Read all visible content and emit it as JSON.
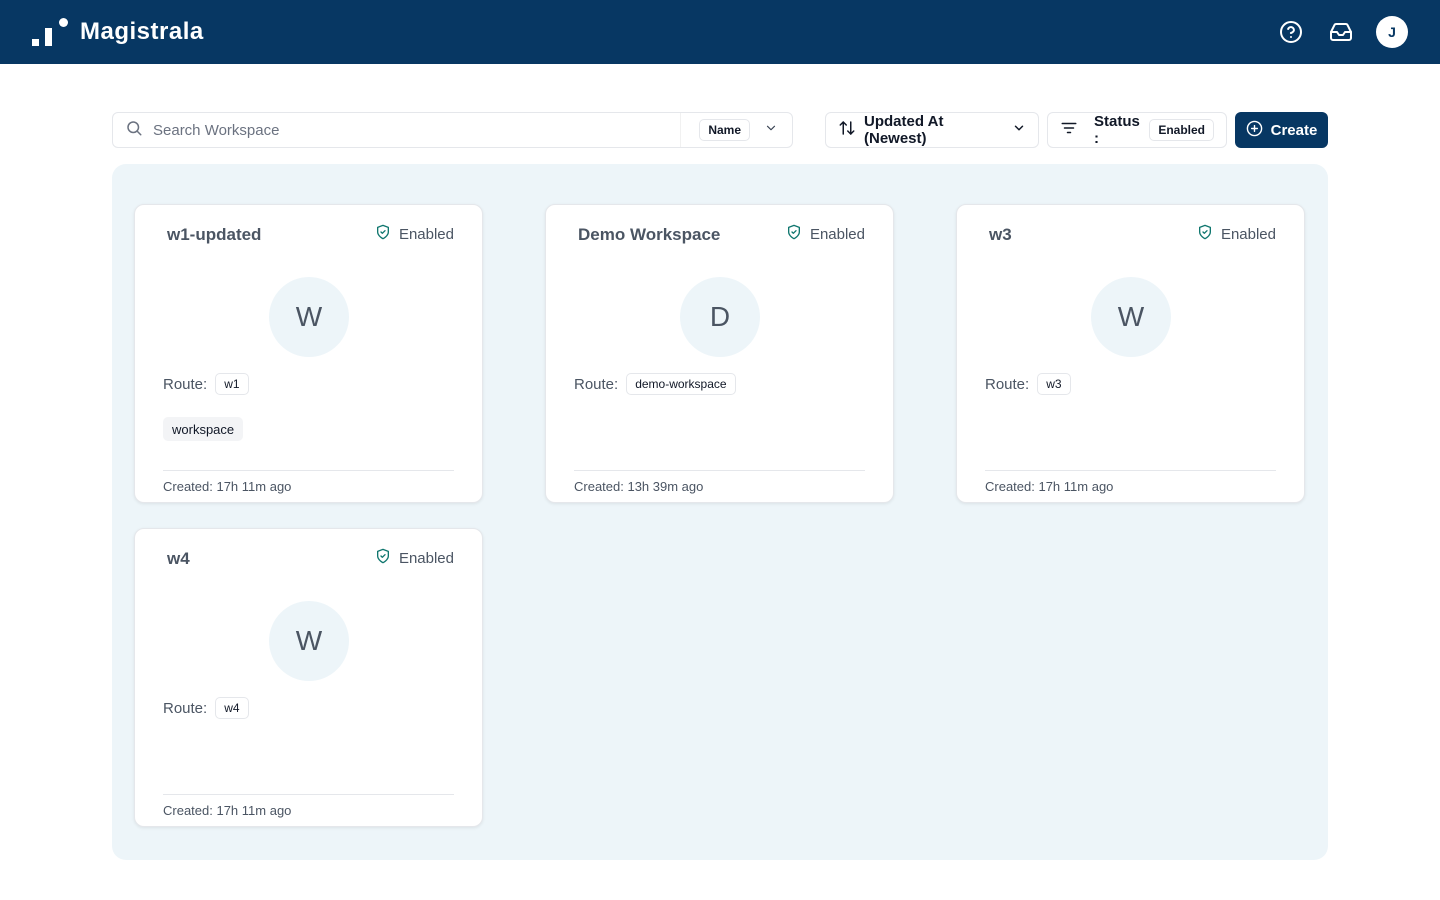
{
  "header": {
    "brand": "Magistrala",
    "user_initial": "J",
    "colors": {
      "header_bg": "#073763",
      "panel_bg": "#edf5f9",
      "enabled": "#0f766e"
    }
  },
  "toolbar": {
    "search_placeholder": "Search Workspace",
    "search_field": "Name",
    "sort_label": "Updated At (Newest)",
    "filter_label": "Status :",
    "filter_value": "Enabled",
    "create_label": "Create"
  },
  "cards": [
    {
      "title": "w1-updated",
      "status": "Enabled",
      "initial": "W",
      "route_label": "Route:",
      "route": "w1",
      "tag": "workspace",
      "created": "Created: 17h 11m ago"
    },
    {
      "title": "Demo Workspace",
      "status": "Enabled",
      "initial": "D",
      "route_label": "Route:",
      "route": "demo-workspace",
      "created": "Created: 13h 39m ago"
    },
    {
      "title": "w3",
      "status": "Enabled",
      "initial": "W",
      "route_label": "Route:",
      "route": "w3",
      "created": "Created: 17h 11m ago"
    },
    {
      "title": "w4",
      "status": "Enabled",
      "initial": "W",
      "route_label": "Route:",
      "route": "w4",
      "created": "Created: 17h 11m ago"
    }
  ]
}
